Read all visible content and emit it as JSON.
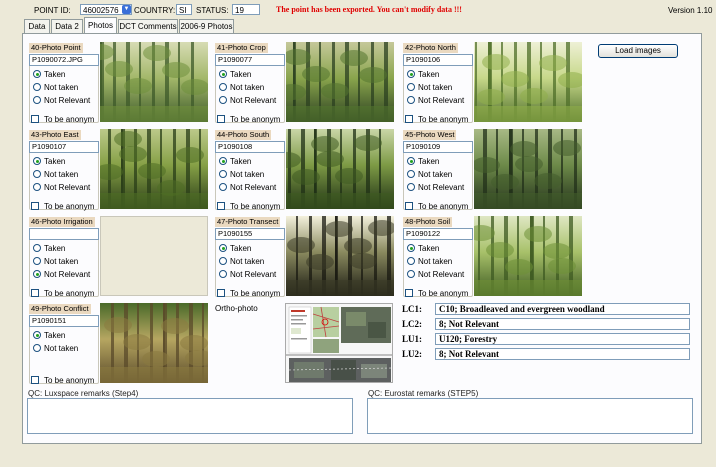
{
  "header": {
    "point_id_label": "POINT ID:",
    "point_id_value": "46002576",
    "country_label": "COUNTRY:",
    "country_value": "SI",
    "status_label": "STATUS:",
    "status_value": "19",
    "warning": "The point has been exported. You can't modify data !!!",
    "version": "Version 1.10"
  },
  "tabs": [
    {
      "label": "Data"
    },
    {
      "label": "Data 2"
    },
    {
      "label": "Photos",
      "active": true
    },
    {
      "label": "DCT Comments"
    },
    {
      "label": "2006-9 Photos"
    }
  ],
  "load_images_label": "Load images",
  "radio_labels": {
    "taken": "Taken",
    "not_taken": "Not taken",
    "not_relevant": "Not Relevant"
  },
  "anonym_label": "To be anonym",
  "photos": [
    {
      "title": "40-Photo Point",
      "file": "P1090072.JPG",
      "selected": "taken"
    },
    {
      "title": "41-Photo Crop",
      "file": "P1090077",
      "selected": "taken"
    },
    {
      "title": "42-Photo North",
      "file": "P1090106",
      "selected": "taken"
    },
    {
      "title": "43-Photo East",
      "file": "P1090107",
      "selected": "taken"
    },
    {
      "title": "44-Photo South",
      "file": "P1090108",
      "selected": "taken"
    },
    {
      "title": "45-Photo West",
      "file": "P1090109",
      "selected": "taken"
    },
    {
      "title": "46-Photo Irrigation",
      "file": "",
      "selected": "not_relevant"
    },
    {
      "title": "47-Photo Transect",
      "file": "P1090155",
      "selected": "taken"
    },
    {
      "title": "48-Photo Soil",
      "file": "P1090122",
      "selected": "taken"
    },
    {
      "title": "49-Photo Conflict",
      "file": "P1090151",
      "selected": "taken"
    }
  ],
  "ortho_label": "Ortho-photo",
  "landcover": [
    {
      "label": "LC1:",
      "value": "C10; Broadleaved and evergreen woodland"
    },
    {
      "label": "LC2:",
      "value": "8; Not Relevant"
    },
    {
      "label": "LU1:",
      "value": "U120; Forestry"
    },
    {
      "label": "LU2:",
      "value": "8; Not Relevant"
    }
  ],
  "remarks": {
    "luxspace_label": "QC: Luxspace remarks (Step4)",
    "luxspace_value": "",
    "eurostat_label": "QC: Eurostat remarks (STEP5)",
    "eurostat_value": ""
  },
  "colors": {
    "warning": "#e00000",
    "group_title_bg": "#ead9c0",
    "window_bg": "#ece9d8"
  }
}
